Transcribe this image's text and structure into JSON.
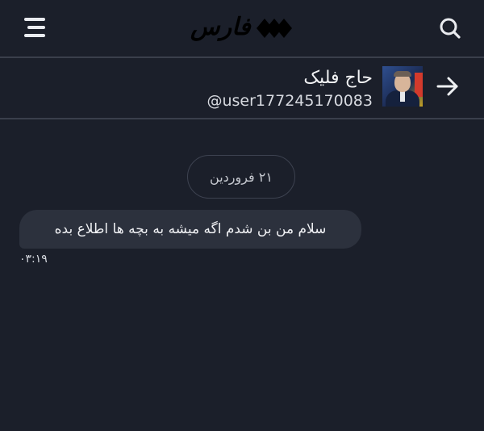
{
  "header": {
    "logo_text": "فارس",
    "menu_icon": "hamburger-menu-icon",
    "search_icon": "search-icon"
  },
  "profile": {
    "name": "حاج فلیک",
    "handle": "@user177245170083",
    "back_icon": "arrow-right-icon"
  },
  "chat": {
    "date_label": "۲۱ فروردین",
    "messages": [
      {
        "text": "سلام من بن شدم اگه میشه به بچه ها اطلاع بده",
        "time": "۰۳:۱۹"
      }
    ]
  },
  "colors": {
    "background": "#1b1f2a",
    "bubble": "#2c313d",
    "divider": "#3a3f4b"
  }
}
